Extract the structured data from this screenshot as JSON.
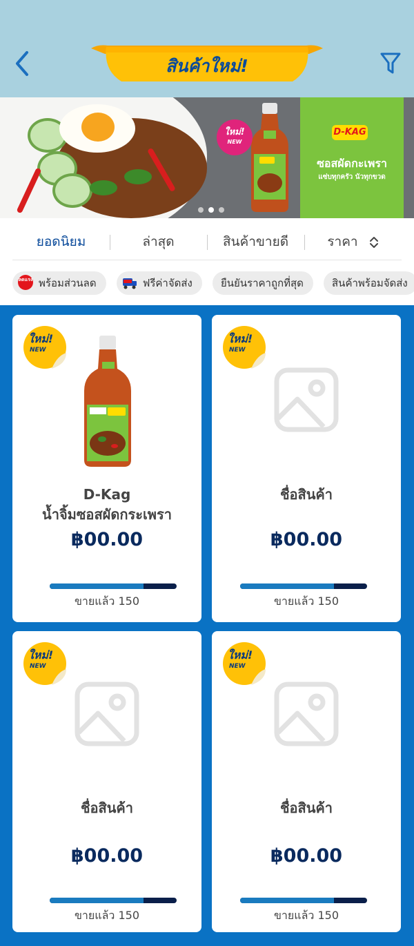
{
  "header": {
    "title": "สินค้าใหม่!"
  },
  "banner": {
    "badge_new_th": "ใหม่!",
    "badge_new_en": "NEW",
    "logo_text": "D-KAG",
    "headline": "ซอสผัดกะเพรา",
    "subline": "แซ่บทุกครัว นัวทุกขวด"
  },
  "sort_tabs": [
    {
      "label": "ยอดนิยม",
      "active": true
    },
    {
      "label": "ล่าสุด",
      "active": false
    },
    {
      "label": "สินค้าขายดี",
      "active": false
    },
    {
      "label": "ราคา",
      "active": false
    }
  ],
  "chips": [
    {
      "label": "พร้อมส่วนลด",
      "icon": "sale-badge-icon",
      "icon_text": "ลดแรง"
    },
    {
      "label": "ฟรีค่าจัดส่ง",
      "icon": "free-shipping-icon",
      "icon_text": "FREE"
    },
    {
      "label": "ยืนยันราคาถูกที่สุด",
      "icon": ""
    },
    {
      "label": "สินค้าพร้อมจัดส่ง",
      "icon": ""
    }
  ],
  "new_badge": {
    "th": "ใหม่!",
    "en": "NEW"
  },
  "products": [
    {
      "name_line1": "D-Kag",
      "name_line2": "น้ำจิ้มซอสผัดกระเพรา",
      "price": "฿00.00",
      "sold_label": "ขายแล้ว",
      "sold_count": "150",
      "sold_ratio": 0.74,
      "has_image": true
    },
    {
      "name_line1": "ชื่อสินค้า",
      "name_line2": "",
      "price": "฿00.00",
      "sold_label": "ขายแล้ว",
      "sold_count": "150",
      "sold_ratio": 0.74,
      "has_image": false
    },
    {
      "name_line1": "ชื่อสินค้า",
      "name_line2": "",
      "price": "฿00.00",
      "sold_label": "ขายแล้ว",
      "sold_count": "150",
      "sold_ratio": 0.74,
      "has_image": false
    },
    {
      "name_line1": "ชื่อสินค้า",
      "name_line2": "",
      "price": "฿00.00",
      "sold_label": "ขายแล้ว",
      "sold_count": "150",
      "sold_ratio": 0.74,
      "has_image": false
    }
  ],
  "colors": {
    "header_bg": "#a9d1df",
    "page_bg": "#0a72c4",
    "title_ribbon": "#ffc107",
    "title_text": "#0a4a9a",
    "price": "#0a2a5e",
    "progress_track": "#0a1f4a",
    "progress_fill": "#1a7bbf"
  }
}
